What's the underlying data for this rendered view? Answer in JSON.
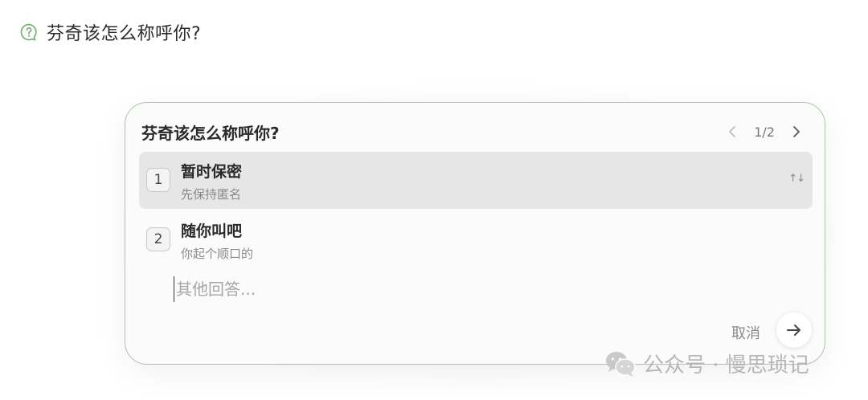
{
  "question_header": {
    "text": "芬奇该怎么称呼你?",
    "icon": "question-circle-icon"
  },
  "card": {
    "title": "芬奇该怎么称呼你?",
    "pager": {
      "current": 1,
      "total": 2,
      "text": "1/2",
      "prev_icon": "chevron-left-icon",
      "next_icon": "chevron-right-icon"
    },
    "options": [
      {
        "number": "1",
        "label": "暂时保密",
        "description": "先保持匿名",
        "selected": true,
        "sort_icon": "↑↓"
      },
      {
        "number": "2",
        "label": "随你叫吧",
        "description": "你起个顺口的",
        "selected": false
      }
    ],
    "other_input": {
      "placeholder": "其他回答...",
      "value": ""
    },
    "cancel_label": "取消",
    "submit_icon": "arrow-right-icon"
  },
  "watermark": {
    "text": "公众号 · 慢思琐记",
    "icon": "wechat-icon"
  },
  "colors": {
    "accent_green": "#7fb07a",
    "card_border": "#a9c7a2",
    "selected_bg": "#e6e6e6"
  }
}
